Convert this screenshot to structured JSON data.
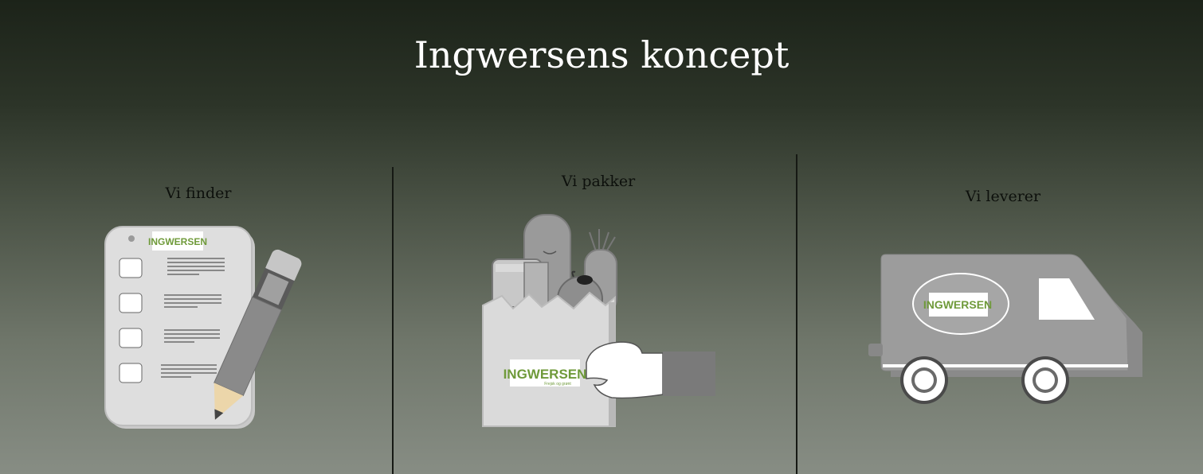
{
  "page": {
    "title": "Ingwersens koncept"
  },
  "steps": [
    {
      "label": "Vi finder",
      "illustration": "checklist-pencil-icon"
    },
    {
      "label": "Vi pakker",
      "illustration": "grocery-bag-icon"
    },
    {
      "label": "Vi leverer",
      "illustration": "delivery-van-icon"
    }
  ],
  "logo": {
    "text": "INGWERSEN",
    "tagline": "Frejsk og grønt"
  },
  "colors": {
    "brand_green": "#6f9a3a",
    "illustration_gray": "#8d8d8d",
    "title_white": "#ffffff"
  }
}
